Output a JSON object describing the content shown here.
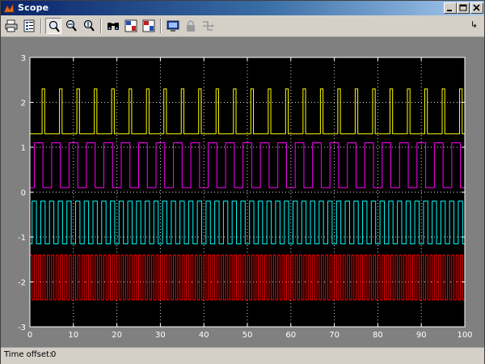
{
  "window": {
    "title": "Scope",
    "title_icon": "matlab-scope-icon",
    "controls": [
      "minimize-icon",
      "maximize-icon",
      "close-icon"
    ]
  },
  "toolbar": {
    "buttons": [
      {
        "name": "print-button",
        "icon": "printer-icon"
      },
      {
        "name": "parameters-button",
        "icon": "parameters-icon"
      },
      {
        "name": "zoom-button",
        "icon": "zoom-icon",
        "pressed": true
      },
      {
        "name": "zoom-x-button",
        "icon": "zoom-x-icon"
      },
      {
        "name": "zoom-y-button",
        "icon": "zoom-y-icon"
      },
      {
        "name": "autoscale-button",
        "icon": "binoculars-icon"
      },
      {
        "name": "save-axes-button",
        "icon": "save-axes-icon"
      },
      {
        "name": "restore-axes-button",
        "icon": "restore-axes-icon"
      },
      {
        "name": "floating-scope-button",
        "icon": "floating-scope-icon"
      },
      {
        "name": "lock-axes-button",
        "icon": "lock-icon",
        "disabled": true
      },
      {
        "name": "signal-selection-button",
        "icon": "signal-selection-icon",
        "disabled": true
      }
    ],
    "dock_icon": "dock-arrow-icon"
  },
  "status": {
    "label": "Time offset:",
    "value": "0"
  },
  "colors": {
    "plot_background": "#000000",
    "figure_background": "#808080",
    "axis_color": "#ffffff",
    "series": [
      "#ffff00",
      "#ff00ff",
      "#00ffff",
      "#ff0000"
    ]
  },
  "chart_data": {
    "type": "line",
    "title": "",
    "xlabel": "",
    "ylabel": "",
    "xlim": [
      0,
      100
    ],
    "ylim": [
      -3,
      3
    ],
    "xticks": [
      0,
      10,
      20,
      30,
      40,
      50,
      60,
      70,
      80,
      90,
      100
    ],
    "yticks": [
      -3,
      -2,
      -1,
      0,
      1,
      2,
      3
    ],
    "xtick_labels": [
      "0",
      "10",
      "20",
      "30",
      "40",
      "50",
      "60",
      "70",
      "80",
      "90",
      "100"
    ],
    "ytick_labels": [
      "-3",
      "-2",
      "-1",
      "0",
      "1",
      "2",
      "3"
    ],
    "grid": true,
    "series": [
      {
        "color": "#ffff00",
        "waveform": "pulse",
        "low": 1.3,
        "high": 2.3,
        "period": 4,
        "high_duration": 0.6,
        "first_rise": 2.8
      },
      {
        "color": "#ff00ff",
        "waveform": "square",
        "low": 0.1,
        "high": 1.1,
        "period": 4,
        "high_duration": 2,
        "first_rise": 1
      },
      {
        "color": "#00ffff",
        "waveform": "square",
        "low": -1.15,
        "high": -0.2,
        "period": 2,
        "high_duration": 1,
        "first_rise": 0.5
      },
      {
        "color": "#ff0000",
        "waveform": "square",
        "low": -2.4,
        "high": -1.4,
        "period": 1,
        "high_duration": 0.5,
        "first_rise": 0
      }
    ]
  }
}
